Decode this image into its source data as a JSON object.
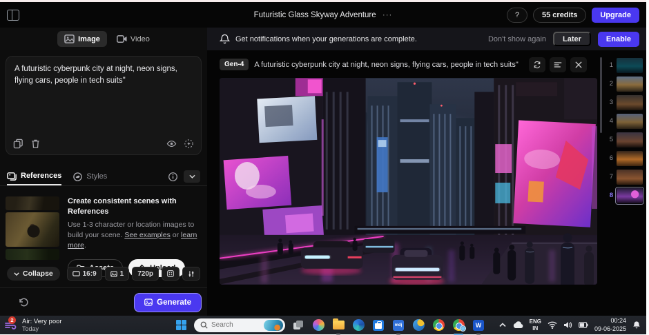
{
  "colors": {
    "accent": "#4a38f0"
  },
  "topbar": {
    "title": "Futuristic Glass Skyway Adventure",
    "title_menu": "···",
    "help": "?",
    "credits": "55 credits",
    "upgrade": "Upgrade"
  },
  "modebar": {
    "image_tab": "Image",
    "video_tab": "Video"
  },
  "notification": {
    "message": "Get notifications when your generations are complete.",
    "dismiss": "Don't show again",
    "later": "Later",
    "enable": "Enable"
  },
  "prompt_panel": {
    "prompt_text": "A futuristic cyberpunk city at night, neon signs, flying cars, people in tech suits\""
  },
  "references": {
    "tab_references": "References",
    "tab_styles": "Styles",
    "heading": "Create consistent scenes with References",
    "body_1": "Use 1-3 character or location images to build your scene. ",
    "link_examples": "See examples",
    "body_or": " or ",
    "link_learn": "learn more",
    "body_end": ".",
    "assets_button": "Assets",
    "upload_button": "Upload"
  },
  "controls": {
    "collapse": "Collapse",
    "aspect_ratio": "16:9",
    "image_count": "1",
    "resolution": "720p",
    "generate": "Generate"
  },
  "viewer": {
    "model_badge": "Gen-4",
    "prompt": "A futuristic cyberpunk city at night, neon signs, flying cars, people in tech suits\""
  },
  "history": {
    "items": [
      {
        "n": "1"
      },
      {
        "n": "2"
      },
      {
        "n": "3"
      },
      {
        "n": "4"
      },
      {
        "n": "5"
      },
      {
        "n": "6"
      },
      {
        "n": "7"
      },
      {
        "n": "8"
      }
    ],
    "selected_index": 8
  },
  "taskbar": {
    "weather_badge": "2",
    "weather_line1": "Air: Very poor",
    "weather_line2": "Today",
    "search_placeholder": "Search",
    "app_blue_label": "mdj",
    "word_label": "W",
    "lang_line1": "ENG",
    "lang_line2": "IN",
    "time": "00:24",
    "date": "09-06-2025"
  }
}
